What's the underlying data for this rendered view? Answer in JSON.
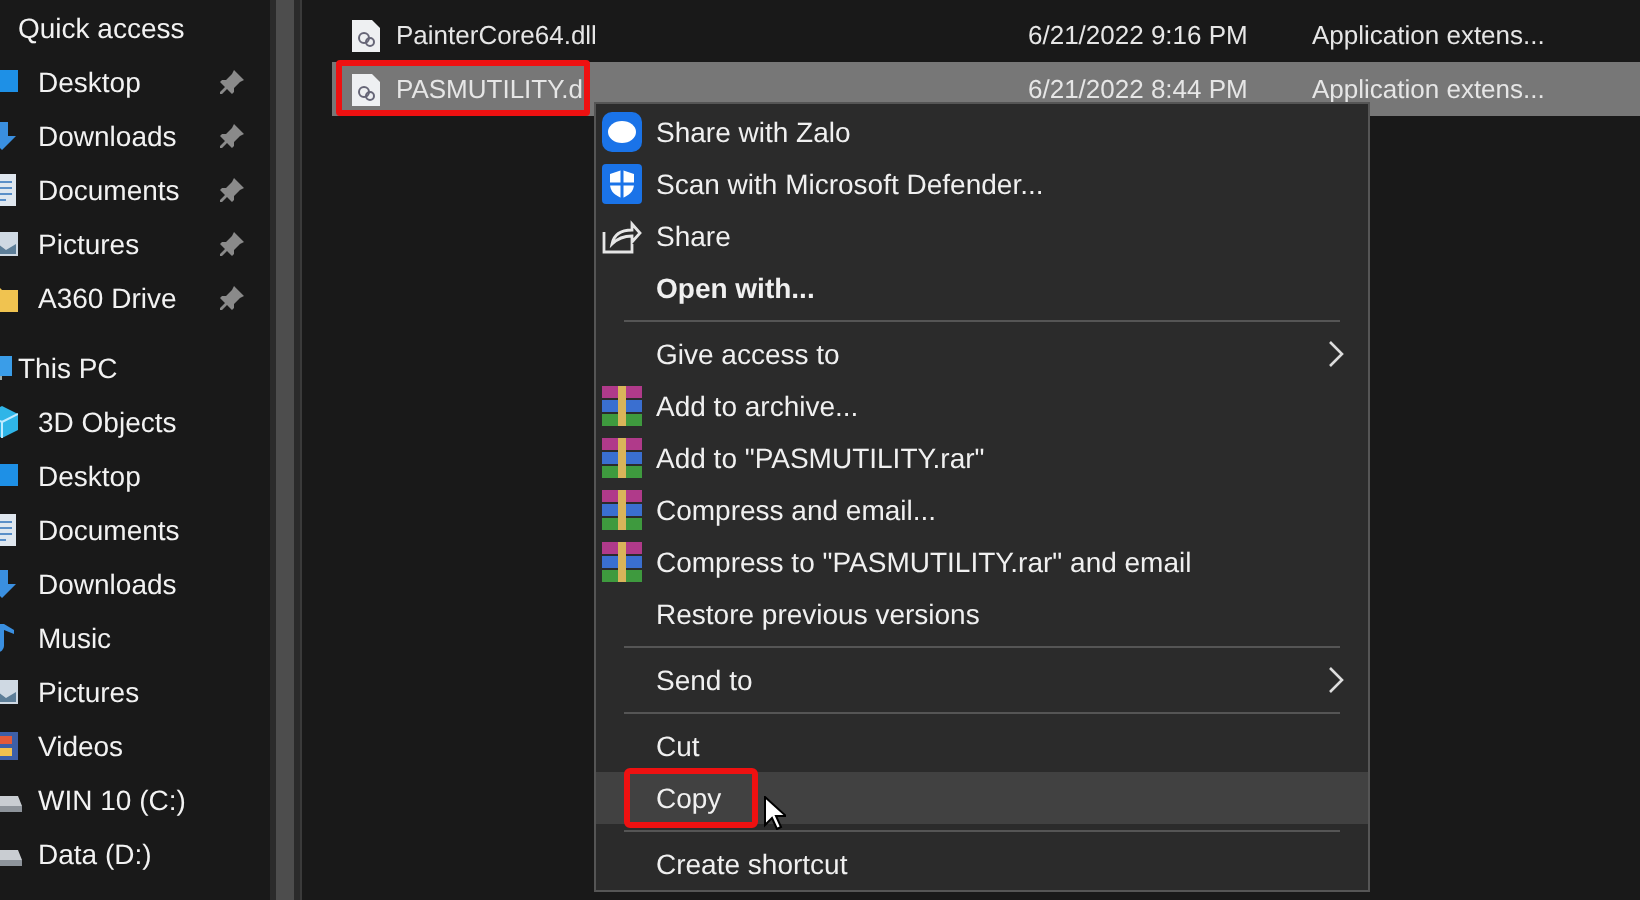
{
  "sidebar": {
    "groups": [
      {
        "label": "Quick access",
        "children": [
          {
            "label": "Desktop",
            "kind": "desktop",
            "pinned": true
          },
          {
            "label": "Downloads",
            "kind": "downloads",
            "pinned": true
          },
          {
            "label": "Documents",
            "kind": "documents",
            "pinned": true
          },
          {
            "label": "Pictures",
            "kind": "pictures",
            "pinned": true
          },
          {
            "label": "A360 Drive",
            "kind": "folder",
            "pinned": true
          }
        ]
      },
      {
        "label": "This PC",
        "kind": "pc",
        "children": [
          {
            "label": "3D Objects",
            "kind": "objects",
            "pinned": false
          },
          {
            "label": "Desktop",
            "kind": "desktop",
            "pinned": false
          },
          {
            "label": "Documents",
            "kind": "documents",
            "pinned": false
          },
          {
            "label": "Downloads",
            "kind": "downloads",
            "pinned": false
          },
          {
            "label": "Music",
            "kind": "music",
            "pinned": false
          },
          {
            "label": "Pictures",
            "kind": "pictures",
            "pinned": false
          },
          {
            "label": "Videos",
            "kind": "videos",
            "pinned": false
          },
          {
            "label": "WIN 10 (C:)",
            "kind": "drive",
            "pinned": false
          },
          {
            "label": "Data (D:)",
            "kind": "drive",
            "pinned": false
          }
        ]
      }
    ]
  },
  "files": [
    {
      "name": "PainterCore64.dll",
      "date": "6/21/2022 9:16 PM",
      "type": "Application extens...",
      "selected": false,
      "annotated": false
    },
    {
      "name": "PASMUTILITY.d",
      "date": "6/21/2022 8:44 PM",
      "type": "Application extens...",
      "selected": true,
      "annotated": true
    }
  ],
  "menu": {
    "items": [
      {
        "kind": "zalo",
        "label": "Share with Zalo",
        "selected": false,
        "annotated": false
      },
      {
        "kind": "shield",
        "label": "Scan with Microsoft Defender...",
        "selected": false,
        "annotated": false
      },
      {
        "kind": "share",
        "label": "Share",
        "selected": false,
        "annotated": false
      },
      {
        "kind": "plain",
        "label": "Open with...",
        "bold": true,
        "selected": false,
        "annotated": false
      },
      {
        "kind": "separator"
      },
      {
        "kind": "plain",
        "label": "Give access to",
        "submenu": true,
        "selected": false,
        "annotated": false
      },
      {
        "kind": "archive",
        "label": "Add to archive...",
        "selected": false,
        "annotated": false
      },
      {
        "kind": "archive",
        "label": "Add to \"PASMUTILITY.rar\"",
        "selected": false,
        "annotated": false
      },
      {
        "kind": "archive",
        "label": "Compress and email...",
        "selected": false,
        "annotated": false
      },
      {
        "kind": "archive",
        "label": "Compress to \"PASMUTILITY.rar\" and email",
        "selected": false,
        "annotated": false
      },
      {
        "kind": "plain",
        "label": "Restore previous versions",
        "selected": false,
        "annotated": false
      },
      {
        "kind": "separator"
      },
      {
        "kind": "plain",
        "label": "Send to",
        "submenu": true,
        "selected": false,
        "annotated": false
      },
      {
        "kind": "separator"
      },
      {
        "kind": "plain",
        "label": "Cut",
        "selected": false,
        "annotated": false
      },
      {
        "kind": "plain",
        "label": "Copy",
        "selected": true,
        "annotated": true
      },
      {
        "kind": "separator"
      },
      {
        "kind": "plain",
        "label": "Create shortcut",
        "selected": false,
        "annotated": false
      }
    ]
  }
}
